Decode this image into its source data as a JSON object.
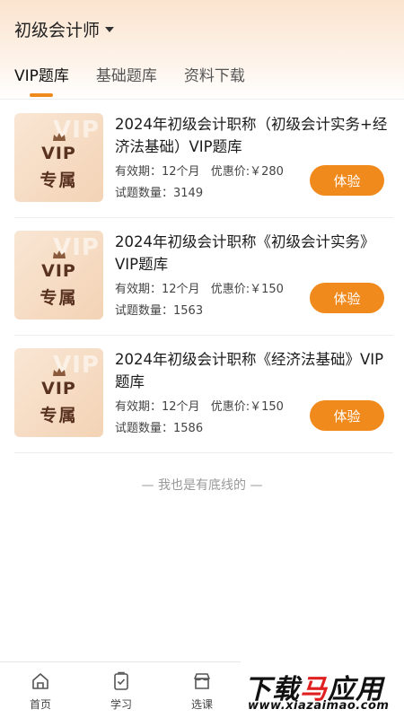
{
  "header": {
    "title": "初级会计师",
    "tabs": [
      {
        "label": "VIP题库",
        "active": true
      },
      {
        "label": "基础题库",
        "active": false
      },
      {
        "label": "资料下载",
        "active": false
      }
    ]
  },
  "thumb": {
    "vip": "VIP",
    "label": "专属"
  },
  "cards": [
    {
      "title": "2024年初级会计职称（初级会计实务+经济法基础）VIP题库",
      "validity": "有效期：12个月",
      "price": "优惠价:￥280",
      "count": "试题数量：3149",
      "button": "体验"
    },
    {
      "title": "2024年初级会计职称《初级会计实务》VIP题库",
      "validity": "有效期：12个月",
      "price": "优惠价:￥150",
      "count": "试题数量：1563",
      "button": "体验"
    },
    {
      "title": "2024年初级会计职称《经济法基础》VIP题库",
      "validity": "有效期：12个月",
      "price": "优惠价:￥150",
      "count": "试题数量：1586",
      "button": "体验"
    }
  ],
  "end_note": "— 我也是有底线的 —",
  "bottom_nav": [
    {
      "label": "首页",
      "icon": "home-icon"
    },
    {
      "label": "学习",
      "icon": "study-icon"
    },
    {
      "label": "选课",
      "icon": "store-icon"
    }
  ],
  "watermark": {
    "main_a": "下载",
    "main_b": "马",
    "main_c": "应用",
    "sub": "www.xiazaimao.com"
  },
  "colors": {
    "accent": "#f08a1c",
    "thumb_text": "#5a3320"
  }
}
